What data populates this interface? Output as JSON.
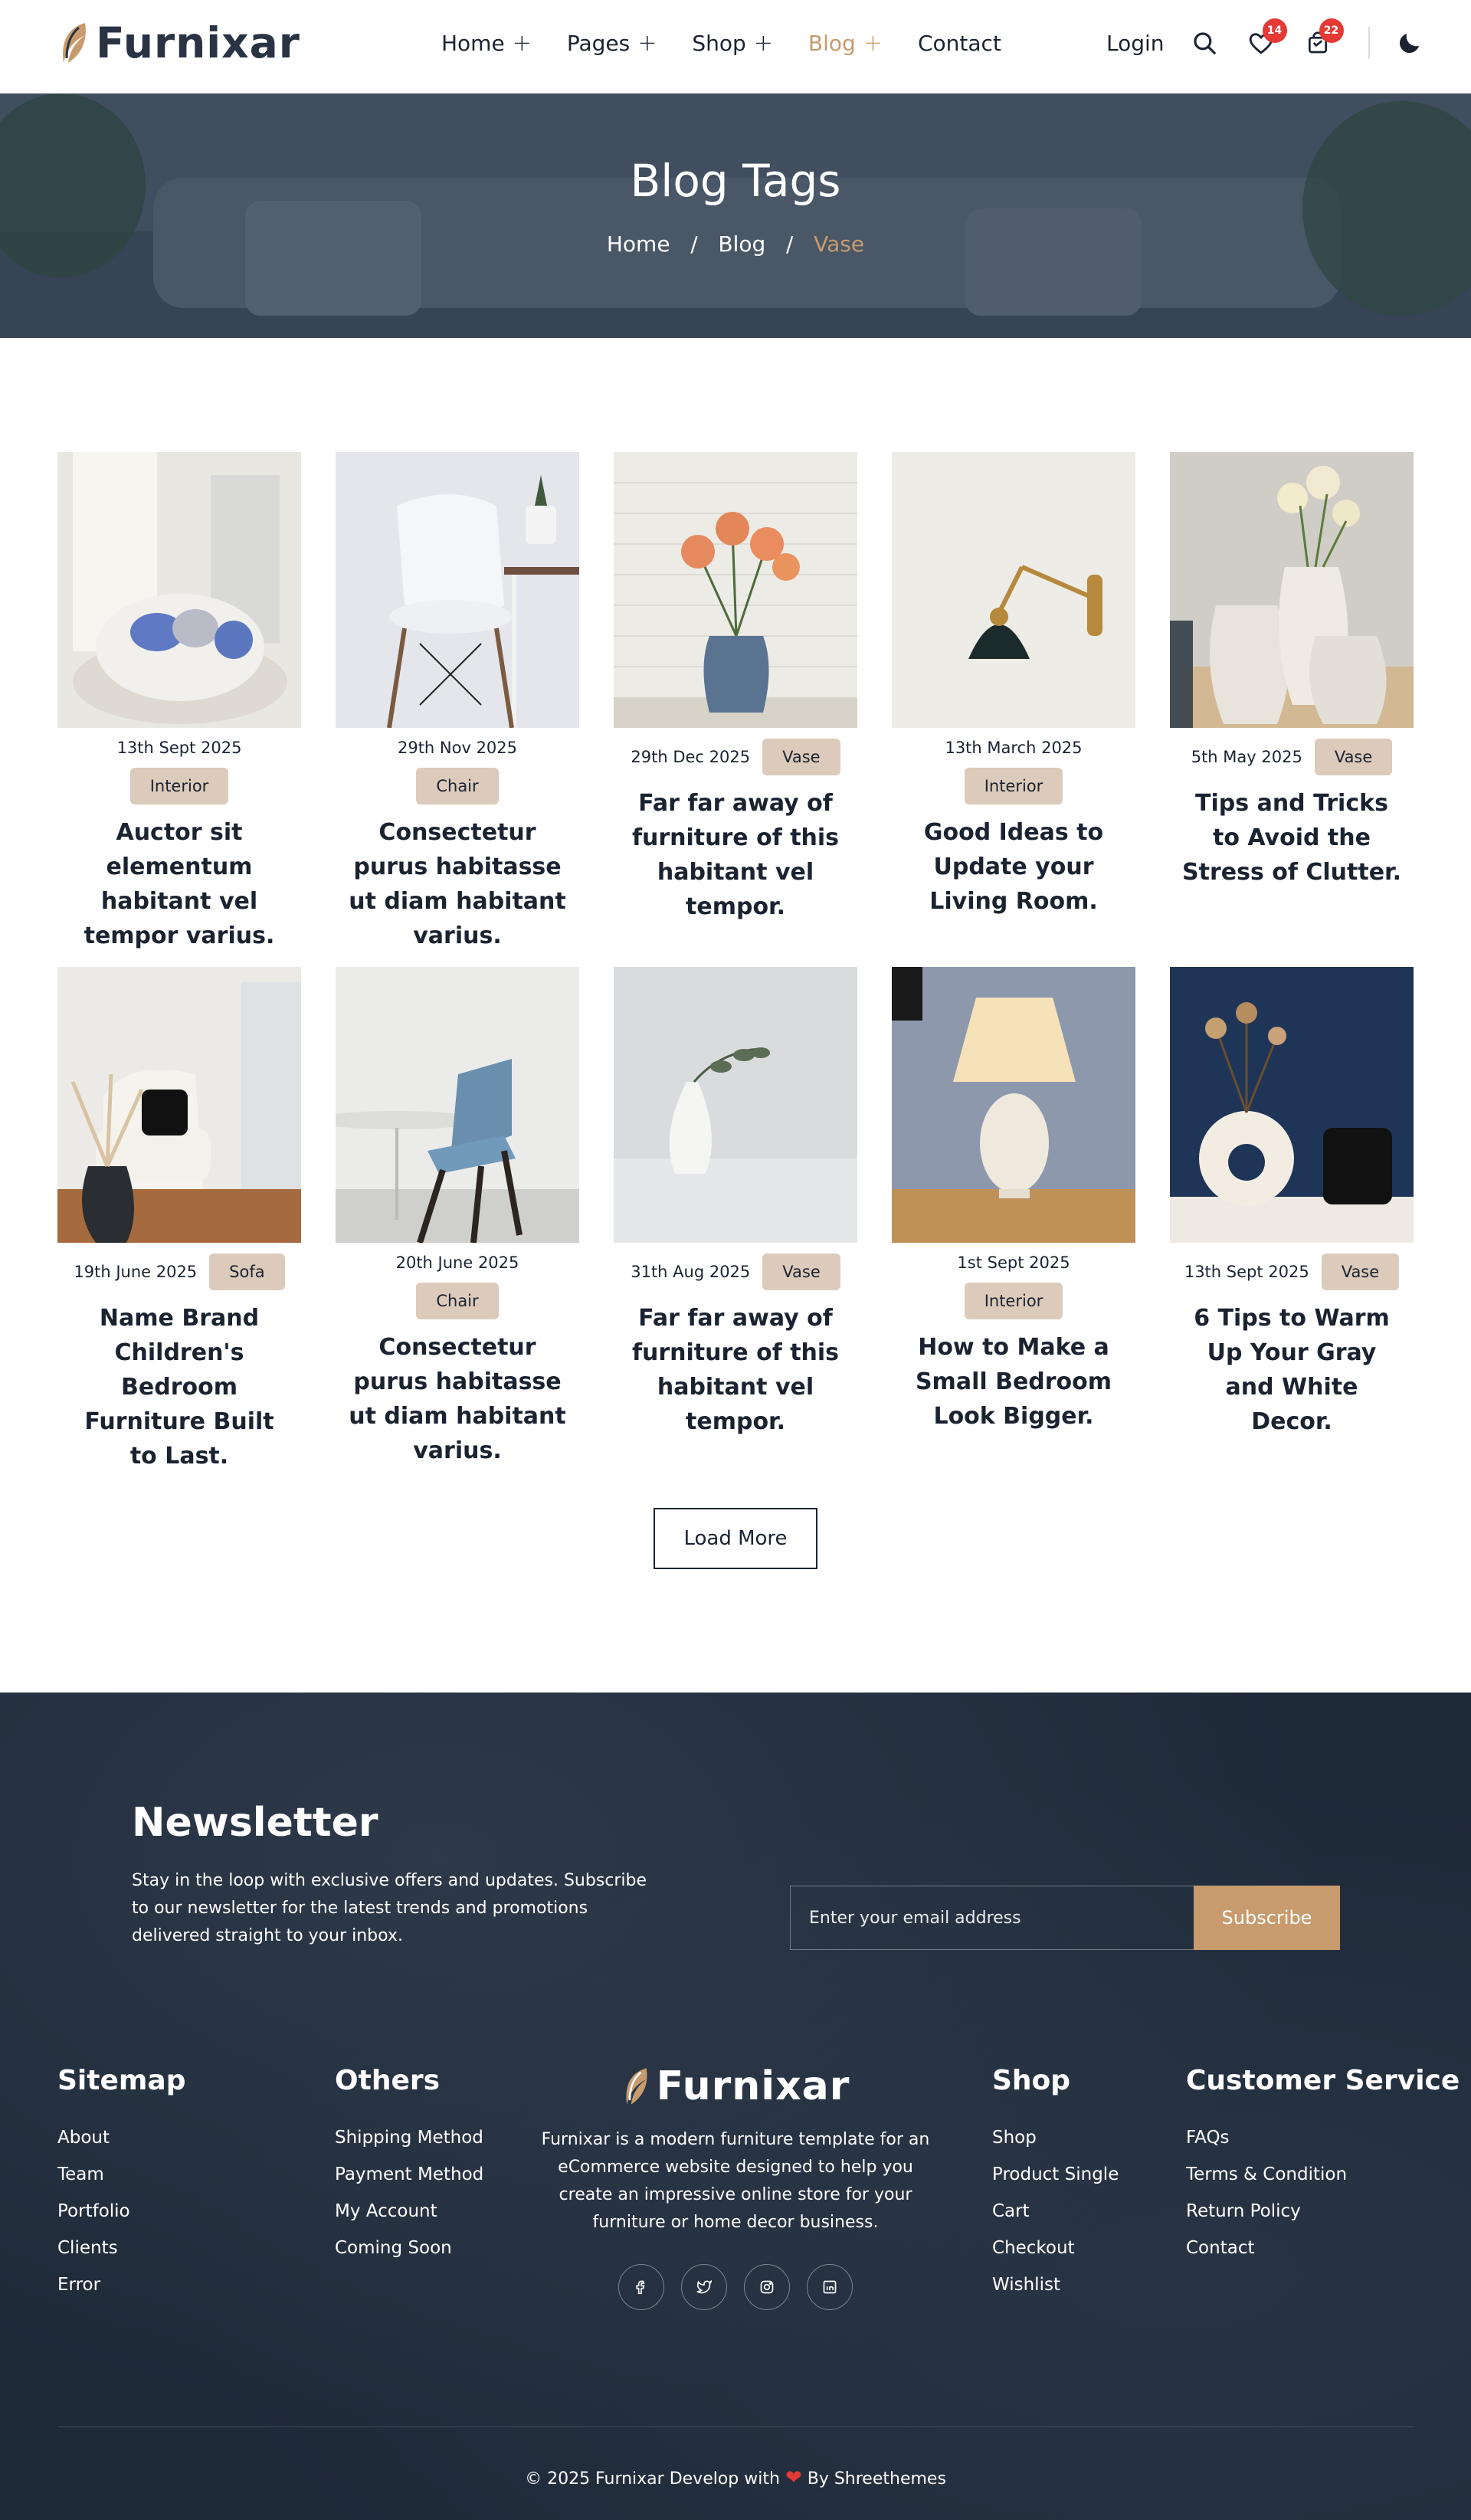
{
  "brand": {
    "name": "Furnixar",
    "accent": "#c79b6d"
  },
  "nav": [
    {
      "label": "Home",
      "has_sub": true
    },
    {
      "label": "Pages",
      "has_sub": true
    },
    {
      "label": "Shop",
      "has_sub": true
    },
    {
      "label": "Blog",
      "has_sub": true,
      "active": true
    },
    {
      "label": "Contact",
      "has_sub": false
    }
  ],
  "header": {
    "login": "Login",
    "wishlist_count": "14",
    "cart_count": "22",
    "icons": [
      "search-icon",
      "heart-icon",
      "bag-icon",
      "moon-icon"
    ]
  },
  "hero": {
    "title": "Blog Tags",
    "crumbs": [
      "Home",
      "Blog",
      "Vase"
    ]
  },
  "posts": [
    {
      "date": "13th Sept 2025",
      "tag": "Interior",
      "title": "Auctor sit elementum habitant vel tempor varius.",
      "inline": false
    },
    {
      "date": "29th Nov 2025",
      "tag": "Chair",
      "title": "Consectetur purus habitasse ut diam habitant varius.",
      "inline": false
    },
    {
      "date": "29th Dec 2025",
      "tag": "Vase",
      "title": "Far far away of furniture of this habitant vel tempor.",
      "inline": true
    },
    {
      "date": "13th March 2025",
      "tag": "Interior",
      "title": "Good Ideas to Update your Living Room.",
      "inline": false
    },
    {
      "date": "5th May 2025",
      "tag": "Vase",
      "title": "Tips and Tricks to Avoid the Stress of Clutter.",
      "inline": true
    },
    {
      "date": "19th June 2025",
      "tag": "Sofa",
      "title": "Name Brand Children's Bedroom Furniture Built to Last.",
      "inline": true
    },
    {
      "date": "20th June 2025",
      "tag": "Chair",
      "title": "Consectetur purus habitasse ut diam habitant varius.",
      "inline": false
    },
    {
      "date": "31th Aug 2025",
      "tag": "Vase",
      "title": "Far far away of furniture of this habitant vel tempor.",
      "inline": true
    },
    {
      "date": "1st Sept 2025",
      "tag": "Interior",
      "title": "How to Make a Small Bedroom Look Bigger.",
      "inline": false
    },
    {
      "date": "13th Sept 2025",
      "tag": "Vase",
      "title": "6 Tips to Warm Up Your Gray and White Decor.",
      "inline": true
    }
  ],
  "load_more": "Load More",
  "newsletter": {
    "title": "Newsletter",
    "text": "Stay in the loop with exclusive offers and updates. Subscribe to our newsletter for the latest trends and promotions delivered straight to your inbox.",
    "placeholder": "Enter your email address",
    "button": "Subscribe"
  },
  "footer": {
    "sitemap": {
      "title": "Sitemap",
      "items": [
        "About",
        "Team",
        "Portfolio",
        "Clients",
        "Error"
      ]
    },
    "others": {
      "title": "Others",
      "items": [
        "Shipping Method",
        "Payment Method",
        "My Account",
        "Coming Soon"
      ]
    },
    "about": "Furnixar is a modern furniture template for an eCommerce website designed to help you create an impressive online store for your furniture or home decor business.",
    "social": [
      "facebook-icon",
      "twitter-icon",
      "instagram-icon",
      "linkedin-icon"
    ],
    "shop": {
      "title": "Shop",
      "items": [
        "Shop",
        "Product Single",
        "Cart",
        "Checkout",
        "Wishlist"
      ]
    },
    "service": {
      "title": "Customer Service",
      "items": [
        "FAQs",
        "Terms & Condition",
        "Return Policy",
        "Contact"
      ]
    },
    "copy_left": "© 2025 Furnixar Develop with",
    "copy_right": "By Shreethemes"
  }
}
